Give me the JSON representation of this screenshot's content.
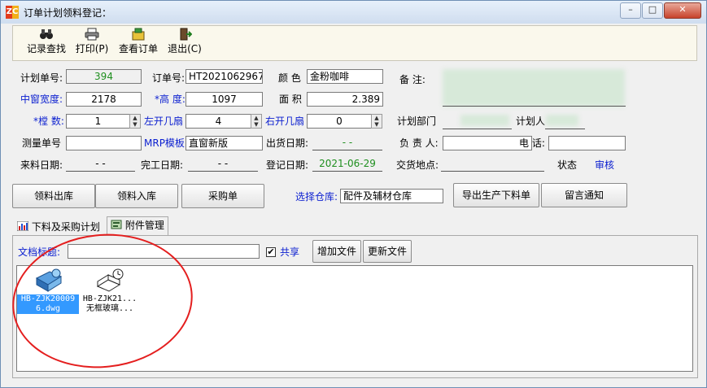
{
  "window": {
    "title": "订单计划领料登记："
  },
  "title_buttons": {
    "minimize": "–",
    "maximize": "□",
    "close": "✕"
  },
  "toolbar": {
    "find": "记录查找",
    "print": "打印(P)",
    "view_order": "查看订单",
    "exit": "退出(C)"
  },
  "form": {
    "plan_no": {
      "label": "计划单号:",
      "value": "394"
    },
    "order_no": {
      "label": "订单号:",
      "value": "HT2021062967"
    },
    "color": {
      "label": "颜  色",
      "value": "金粉咖啡"
    },
    "remark": {
      "label": "备  注:"
    },
    "window_width": {
      "label": "中窗宽度:",
      "value": "2178"
    },
    "height": {
      "label": "*高  度:",
      "value": "1097"
    },
    "area": {
      "label": "面  积",
      "value": "2.389"
    },
    "sash_count": {
      "label": "*樘  数:",
      "value": "1"
    },
    "left_sash": {
      "label": "左开几扇",
      "value": "4"
    },
    "right_sash": {
      "label": "右开几扇",
      "value": "0"
    },
    "plan_dept": {
      "label": "计划部门"
    },
    "planner": {
      "label": "计划人"
    },
    "measure_no": {
      "label": "测量单号",
      "value": ""
    },
    "mrp_template": {
      "label": "MRP模板",
      "value": "直窗新版"
    },
    "ship_date": {
      "label": "出货日期:",
      "value": "- -"
    },
    "responsible": {
      "label": "负 责 人:"
    },
    "phone": {
      "label": "电  话:"
    },
    "arrival_date": {
      "label": "来料日期:",
      "value": "- -"
    },
    "finish_date": {
      "label": "完工日期:",
      "value": "- -"
    },
    "reg_date": {
      "label": "登记日期:",
      "value": "2021-06-29"
    },
    "delivery_place": {
      "label": "交货地点:"
    },
    "status": {
      "label": "状态",
      "value": "审核"
    }
  },
  "actions": {
    "material_out": "领料出库",
    "material_in": "领料入库",
    "purchase": "采购单",
    "warehouse_label": "选择仓库:",
    "warehouse_value": "配件及辅材仓库",
    "export": "导出生产下料单",
    "message": "留言通知"
  },
  "tabs": [
    {
      "label": "下料及采购计划"
    },
    {
      "label": "附件管理"
    }
  ],
  "attachments": {
    "title_label": "文档标题:",
    "title_value": "",
    "share_label": "共享",
    "share_checked": "✔",
    "add_file": "增加文件",
    "update_file": "更新文件",
    "files": [
      {
        "line1": "HB-ZJK20009",
        "line2": "6.dwg",
        "icon": "dwg-file-icon"
      },
      {
        "line1": "HB-ZJK21...",
        "line2": "无框玻璃...",
        "icon": "book-clock-icon"
      }
    ]
  },
  "colors": {
    "accent_blue": "#0b1fd0",
    "value_green": "#1f8f1f",
    "highlight": "#3399ff",
    "annotation_red": "#e41e1e"
  }
}
